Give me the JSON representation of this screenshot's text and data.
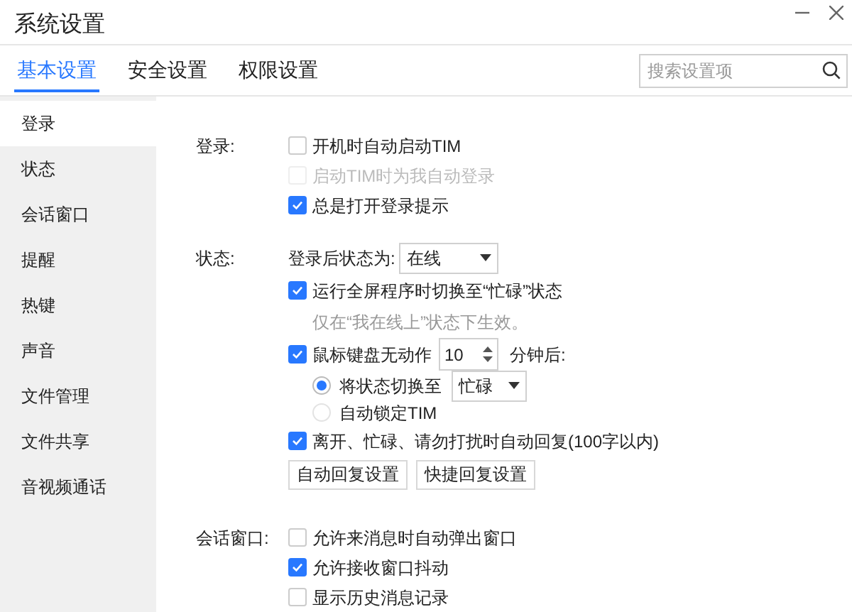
{
  "window": {
    "title": "系统设置"
  },
  "tabs": [
    {
      "label": "基本设置",
      "selected": true
    },
    {
      "label": "安全设置",
      "selected": false
    },
    {
      "label": "权限设置",
      "selected": false
    }
  ],
  "search": {
    "placeholder": "搜索设置项"
  },
  "sidebar": {
    "items": [
      {
        "label": "登录",
        "selected": true
      },
      {
        "label": "状态",
        "selected": false
      },
      {
        "label": "会话窗口",
        "selected": false
      },
      {
        "label": "提醒",
        "selected": false
      },
      {
        "label": "热键",
        "selected": false
      },
      {
        "label": "声音",
        "selected": false
      },
      {
        "label": "文件管理",
        "selected": false
      },
      {
        "label": "文件共享",
        "selected": false
      },
      {
        "label": "音视频通话",
        "selected": false
      }
    ]
  },
  "sections": [
    {
      "label": "登录:",
      "rows": [
        {
          "kind": "checkbox",
          "label": "开机时自动启动TIM",
          "checked": false,
          "disabled": false
        },
        {
          "kind": "checkbox",
          "label": "启动TIM时为我自动登录",
          "checked": false,
          "disabled": true
        },
        {
          "kind": "checkbox",
          "label": "总是打开登录提示",
          "checked": true,
          "disabled": false
        }
      ]
    },
    {
      "label": "状态:",
      "rows": [
        {
          "kind": "select",
          "label": "登录后状态为:",
          "value": "在线"
        },
        {
          "kind": "checkbox",
          "label": "运行全屏程序时切换至“忙碌”状态",
          "checked": true,
          "disabled": false
        },
        {
          "kind": "note",
          "text": "仅在“我在线上”状态下生效。"
        },
        {
          "kind": "spinner",
          "label": "鼠标键盘无动作",
          "checked": true,
          "value": "10",
          "suffix": "分钟后:"
        },
        {
          "kind": "radio",
          "label": "将状态切换至",
          "selected": true,
          "value": "忙碌"
        },
        {
          "kind": "radio",
          "label": "自动锁定TIM",
          "selected": false
        },
        {
          "kind": "checkbox",
          "label": "离开、忙碌、请勿打扰时自动回复(100字以内)",
          "checked": true,
          "disabled": false
        },
        {
          "kind": "buttons",
          "buttons": [
            "自动回复设置",
            "快捷回复设置"
          ]
        }
      ]
    },
    {
      "label": "会话窗口:",
      "rows": [
        {
          "kind": "checkbox",
          "label": "允许来消息时自动弹出窗口",
          "checked": false,
          "disabled": false
        },
        {
          "kind": "checkbox",
          "label": "允许接收窗口抖动",
          "checked": true,
          "disabled": false
        },
        {
          "kind": "checkbox",
          "label": "显示历史消息记录",
          "checked": false,
          "disabled": false
        }
      ]
    }
  ]
}
